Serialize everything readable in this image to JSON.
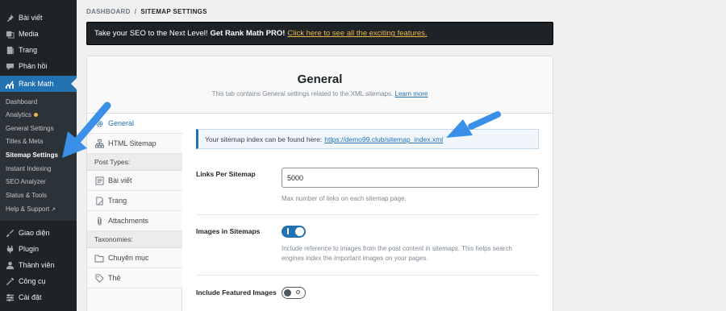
{
  "sidebar": {
    "items": [
      {
        "label": "Bài viết",
        "icon": "pin-icon"
      },
      {
        "label": "Media",
        "icon": "media-icon"
      },
      {
        "label": "Trang",
        "icon": "page-icon"
      },
      {
        "label": "Phản hồi",
        "icon": "comment-icon"
      },
      {
        "label": "Rank Math",
        "icon": "rank-math-icon"
      }
    ],
    "submenu": [
      {
        "label": "Dashboard"
      },
      {
        "label": "Analytics"
      },
      {
        "label": "General Settings"
      },
      {
        "label": "Titles & Meta"
      },
      {
        "label": "Sitemap Settings"
      },
      {
        "label": "Instant Indexing"
      },
      {
        "label": "SEO Analyzer"
      },
      {
        "label": "Status & Tools"
      },
      {
        "label": "Help & Support"
      }
    ],
    "bottom_items": [
      {
        "label": "Giao diện",
        "icon": "brush-icon"
      },
      {
        "label": "Plugin",
        "icon": "plugin-icon"
      },
      {
        "label": "Thành viên",
        "icon": "user-icon"
      },
      {
        "label": "Công cụ",
        "icon": "wrench-icon"
      },
      {
        "label": "Cài đặt",
        "icon": "settings-icon"
      }
    ]
  },
  "breadcrumb": {
    "parent": "DASHBOARD",
    "separator": "/",
    "current": "SITEMAP SETTINGS"
  },
  "promo": {
    "text": "Take your SEO to the Next Level!",
    "bold": "Get Rank Math PRO!",
    "link": "Click here to see all the exciting features."
  },
  "panel": {
    "title": "General",
    "description": "This tab contains General settings related to the XML sitemaps.",
    "learn_more": "Learn more"
  },
  "tabs": {
    "general": "General",
    "html_sitemap": "HTML Sitemap",
    "post_types_header": "Post Types:",
    "posts": "Bài viết",
    "pages": "Trang",
    "attachments": "Attachments",
    "taxonomies_header": "Taxonomies:",
    "categories": "Chuyên mục",
    "tags": "Thẻ"
  },
  "content": {
    "notice_text": "Your sitemap index can be found here:",
    "notice_link": "https://demo99.club/sitemap_index.xml",
    "links_label": "Links Per Sitemap",
    "links_value": "5000",
    "links_help": "Max number of links on each sitemap page.",
    "images_label": "Images in Sitemaps",
    "images_enabled": true,
    "images_help_1": "Include reference to images from the post content in sitemaps. This helps search",
    "images_help_2": "engines index the important images on your pages.",
    "featured_label": "Include Featured Images",
    "featured_enabled": false
  },
  "colors": {
    "accent": "#2271b1",
    "sidebar_bg": "#1d2327",
    "promo_link": "#f0b849",
    "annotation_arrow": "#3a8fe8"
  }
}
